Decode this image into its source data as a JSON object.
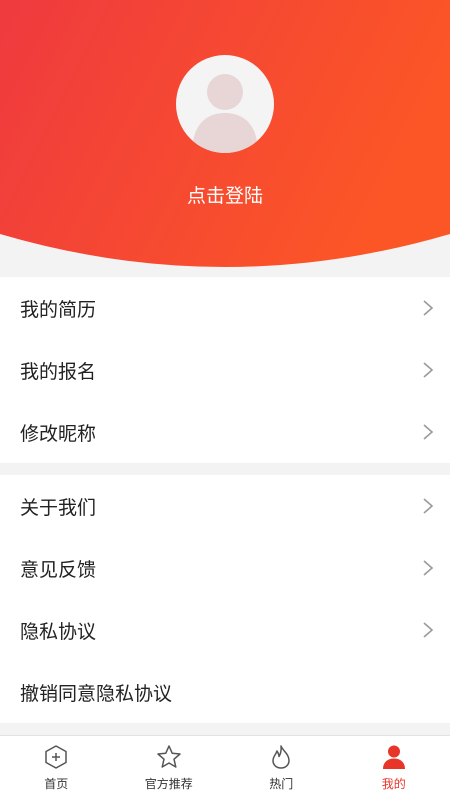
{
  "header": {
    "login_text": "点击登陆",
    "gradient_start": "#ef3a3f",
    "gradient_end": "#fc5626"
  },
  "menu": {
    "group1": [
      {
        "label": "我的简历",
        "has_arrow": true
      },
      {
        "label": "我的报名",
        "has_arrow": true
      },
      {
        "label": "修改昵称",
        "has_arrow": true
      }
    ],
    "group2": [
      {
        "label": "关于我们",
        "has_arrow": true
      },
      {
        "label": "意见反馈",
        "has_arrow": true
      },
      {
        "label": "隐私协议",
        "has_arrow": true
      },
      {
        "label": "撤销同意隐私协议",
        "has_arrow": false
      }
    ]
  },
  "tabbar": {
    "active_color": "#e8352a",
    "items": [
      {
        "label": "首页",
        "icon": "home-plus-icon",
        "active": false
      },
      {
        "label": "官方推荐",
        "icon": "star-icon",
        "active": false
      },
      {
        "label": "热门",
        "icon": "flame-icon",
        "active": false
      },
      {
        "label": "我的",
        "icon": "user-icon",
        "active": true
      }
    ]
  }
}
